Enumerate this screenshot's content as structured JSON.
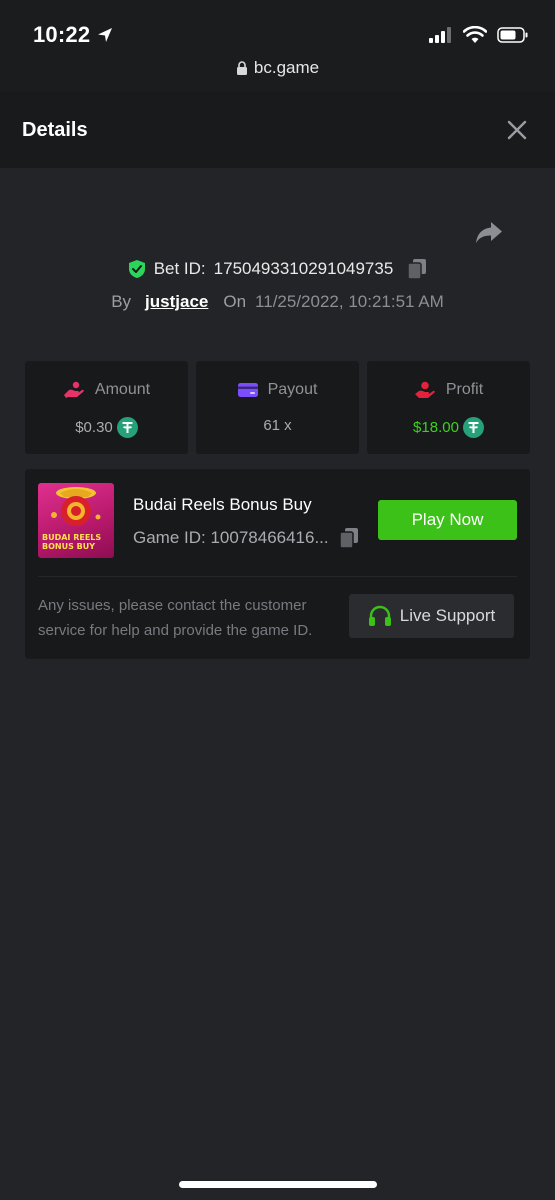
{
  "status_bar": {
    "time": "10:22",
    "icons": [
      "location-arrow-icon",
      "cellular-signal-icon",
      "wifi-icon",
      "battery-icon"
    ]
  },
  "browser": {
    "url": "bc.game",
    "icon": "lock-icon"
  },
  "header": {
    "title": "Details",
    "close_icon": "close-icon"
  },
  "share_icon": "share-icon",
  "bet": {
    "id_label": "Bet ID:",
    "id_value": "1750493310291049735",
    "by_label": "By",
    "username": "justjace",
    "on_label": "On",
    "datetime": "11/25/2022, 10:21:51 AM"
  },
  "stats": [
    {
      "label": "Amount",
      "value": "$0.30",
      "icon": "amount-hand-icon",
      "currency_icon": "tether-icon"
    },
    {
      "label": "Payout",
      "value": "61 x",
      "icon": "payout-card-icon"
    },
    {
      "label": "Profit",
      "value": "$18.00",
      "icon": "profit-hand-icon",
      "currency_icon": "tether-icon"
    }
  ],
  "game": {
    "name": "Budai Reels Bonus Buy",
    "id_text": "Game ID: 10078466416...",
    "thumb_text_1": "BUDAI REELS",
    "thumb_text_2": "BONUS BUY",
    "play_label": "Play Now",
    "notice": "Any issues, please contact the customer service for help and provide the game ID.",
    "support_label": "Live Support"
  },
  "colors": {
    "background": "#232427",
    "card": "#18191b",
    "accent_green": "#3bc117",
    "profit_green": "#3dd11f",
    "shield_green": "#2bd45b",
    "amount_pink": "#e8336a",
    "payout_purple": "#7b4dff",
    "profit_red": "#e2233b",
    "tether": "#26a17b"
  }
}
